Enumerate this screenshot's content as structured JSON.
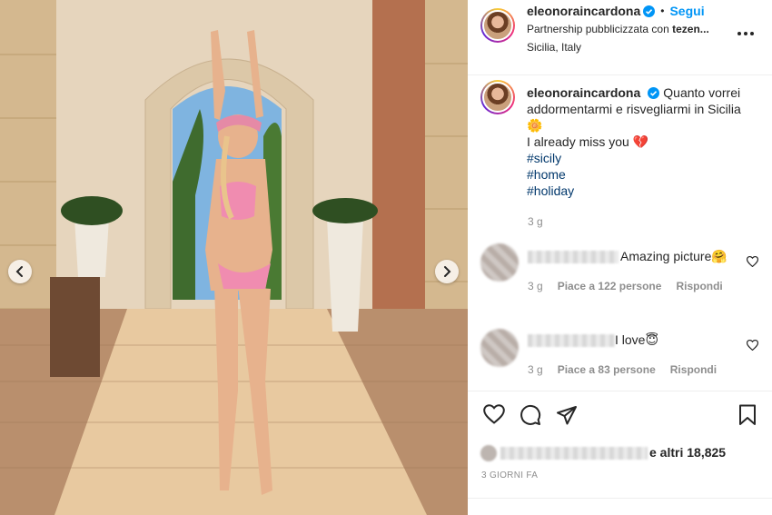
{
  "post": {
    "username": "eleonoraincardona",
    "follow_label": "Segui",
    "separator": "•",
    "partnership_prefix": "Partnership pubblicizzata con",
    "partner_name": "tezen...",
    "location": "Sicilia, Italy"
  },
  "caption": {
    "username": "eleonoraincardona",
    "text_line1": "Quanto vorrei addormentarmi e risvegliarmi in Sicilia",
    "emoji_sun": "🌼",
    "text_line2": "I already miss you",
    "emoji_heart": "💔",
    "hashtags": [
      "#sicily",
      "#home",
      "#holiday"
    ],
    "time": "3 g"
  },
  "comments": [
    {
      "text": "Amazing picture",
      "emoji": "🤗",
      "time": "3 g",
      "likes_label": "Piace a 122 persone",
      "reply_label": "Rispondi"
    },
    {
      "text": "I love",
      "emoji": "😇",
      "time": "3 g",
      "likes_label": "Piace a 83 persone",
      "reply_label": "Rispondi"
    }
  ],
  "likes": {
    "suffix": "e altri 18,825"
  },
  "date_label": "3 GIORNI FA",
  "icons": {
    "like": "heart-icon",
    "comment": "comment-icon",
    "share": "paper-plane-icon",
    "save": "bookmark-icon",
    "more": "more-options-icon",
    "prev": "chevron-left-icon",
    "next": "chevron-right-icon"
  },
  "colors": {
    "link_blue": "#0095f6",
    "hashtag": "#00376b",
    "muted": "#8e8e8e",
    "text": "#262626"
  }
}
